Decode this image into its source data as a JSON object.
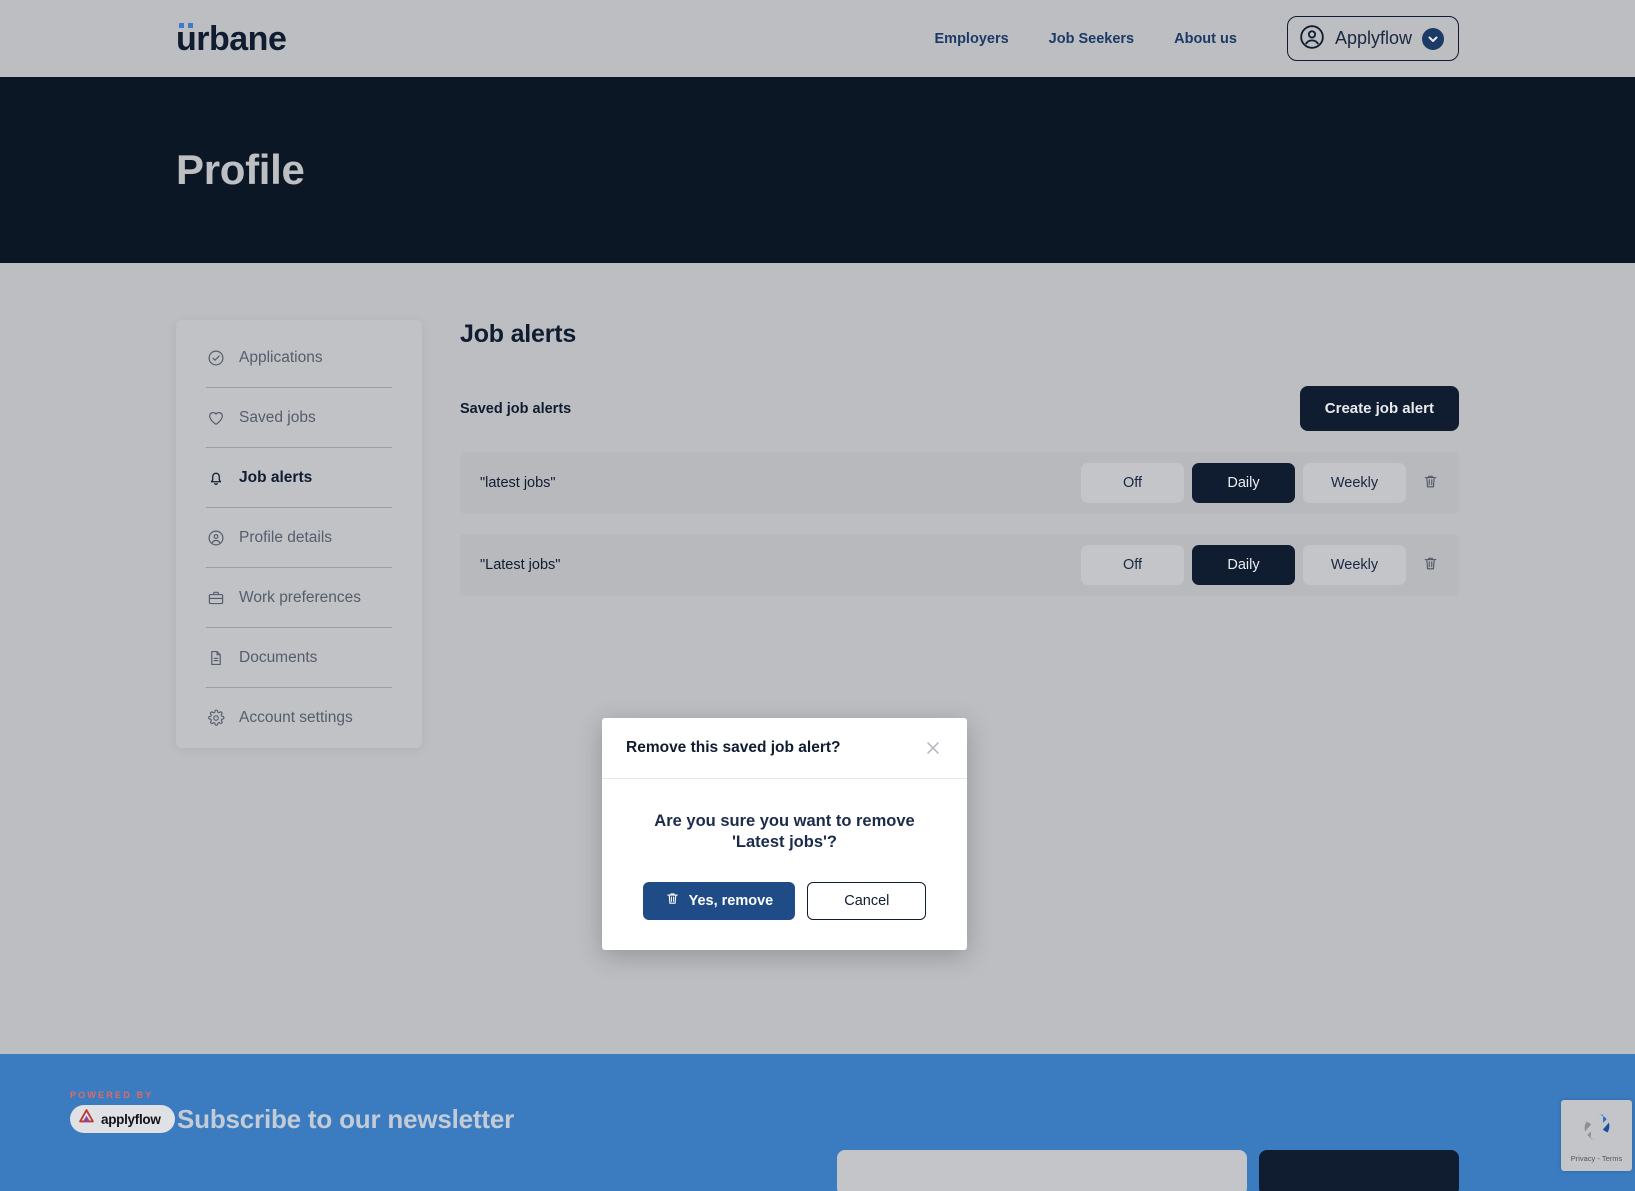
{
  "header": {
    "logo_text": "urbane",
    "nav": [
      {
        "label": "Employers"
      },
      {
        "label": "Job Seekers"
      },
      {
        "label": "About us"
      }
    ],
    "user_menu": {
      "name": "Applyflow",
      "avatar_icon": "user-circle-icon",
      "chevron_icon": "chevron-down-icon"
    }
  },
  "hero": {
    "title": "Profile"
  },
  "sidebar": {
    "items": [
      {
        "label": "Applications",
        "icon": "check-circle-icon",
        "active": false
      },
      {
        "label": "Saved jobs",
        "icon": "heart-icon",
        "active": false
      },
      {
        "label": "Job alerts",
        "icon": "bell-icon",
        "active": true
      },
      {
        "label": "Profile details",
        "icon": "user-circle-icon",
        "active": false
      },
      {
        "label": "Work preferences",
        "icon": "briefcase-icon",
        "active": false
      },
      {
        "label": "Documents",
        "icon": "document-icon",
        "active": false
      },
      {
        "label": "Account settings",
        "icon": "gear-icon",
        "active": false
      }
    ]
  },
  "main": {
    "title": "Job alerts",
    "subtitle": "Saved job alerts",
    "create_button": "Create job alert",
    "frequency_options": [
      "Off",
      "Daily",
      "Weekly"
    ],
    "alerts": [
      {
        "name": "\"latest jobs\"",
        "frequency": "Daily",
        "delete_icon": "trash-icon"
      },
      {
        "name": "\"Latest jobs\"",
        "frequency": "Daily",
        "delete_icon": "trash-icon"
      }
    ]
  },
  "modal": {
    "title": "Remove this saved job alert?",
    "close_icon": "close-icon",
    "message": "Are you sure you want to remove 'Latest jobs'?",
    "confirm_label": "Yes, remove",
    "confirm_icon": "trash-icon",
    "cancel_label": "Cancel"
  },
  "footer": {
    "powered_by_label": "POWERED BY",
    "brand": "applyflow",
    "newsletter_heading": "Subscribe to our newsletter",
    "email_placeholder": "",
    "subscribe_label": ""
  },
  "recaptcha": {
    "text": "Privacy - Terms",
    "icon": "recaptcha-icon"
  },
  "colors": {
    "page_bg": "#bcbec2",
    "hero_bg": "#0c1726",
    "navy": "#101c30",
    "accent_blue": "#3b7cc0",
    "confirm_blue": "#1f4b86",
    "nav_link": "#1b3a66",
    "powered_red": "#e06a63"
  }
}
